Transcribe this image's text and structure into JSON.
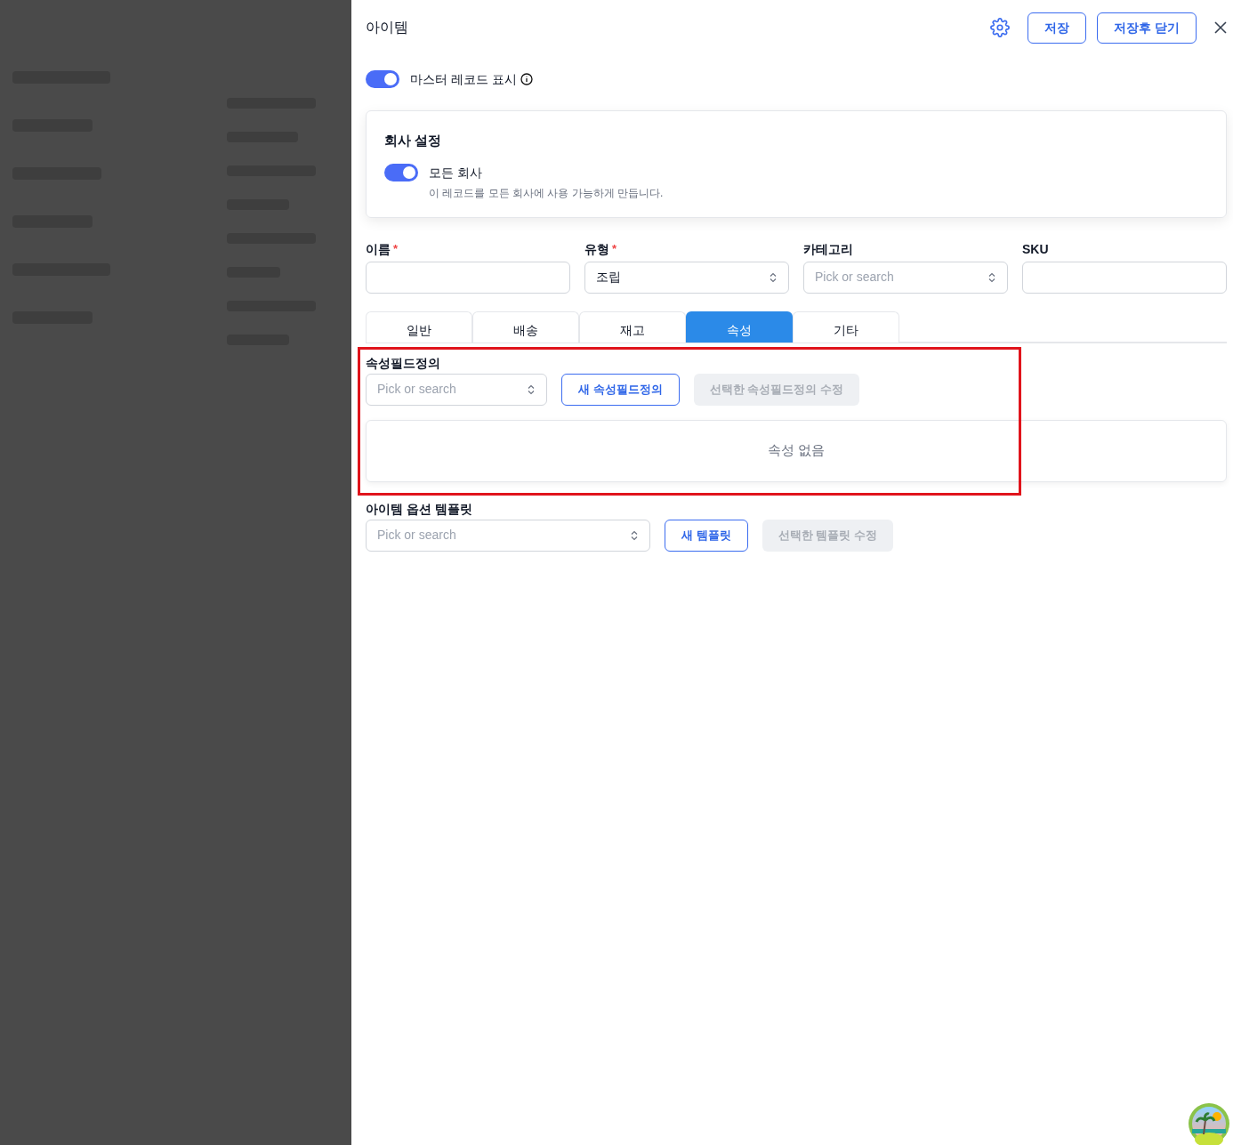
{
  "panel": {
    "title": "아이템",
    "buttons": [
      {
        "label": "저장"
      },
      {
        "label": "저장후 닫기"
      }
    ]
  },
  "master_record_toggle": {
    "label": "마스터 레코드 표시",
    "on": true
  },
  "company_settings": {
    "title": "회사 설정",
    "all_companies": {
      "label": "모든 회사",
      "on": true,
      "description": "이 레코드를 모든 회사에 사용 가능하게 만듭니다."
    }
  },
  "fields": [
    {
      "label": "이름",
      "required_mark": "*",
      "kind": "text"
    },
    {
      "label": "유형",
      "required_mark": "*",
      "kind": "select",
      "value": "조립"
    },
    {
      "label": "카테고리",
      "kind": "select",
      "placeholder": "Pick or search"
    },
    {
      "label": "SKU",
      "kind": "text"
    }
  ],
  "tabs": [
    {
      "label": "일반",
      "selected": false
    },
    {
      "label": "배송",
      "selected": false
    },
    {
      "label": "재고",
      "selected": false
    },
    {
      "label": "속성",
      "selected": true
    },
    {
      "label": "기타",
      "selected": false
    }
  ],
  "attribute_section": {
    "highlighted": true,
    "label": "속성필드정의",
    "select": {
      "placeholder": "Pick or search"
    },
    "buttons": [
      {
        "label": "새 속성필드정의",
        "disabled": false
      },
      {
        "label": "선택한 속성필드정의 수정",
        "disabled": true
      }
    ],
    "empty_message": "속성 없음"
  },
  "option_template": {
    "label": "아이템 옵션 템플릿",
    "select": {
      "placeholder": "Pick or search"
    },
    "buttons": [
      {
        "label": "새 템플릿",
        "disabled": false
      },
      {
        "label": "선택한 템플릿 수정",
        "disabled": true
      }
    ]
  }
}
